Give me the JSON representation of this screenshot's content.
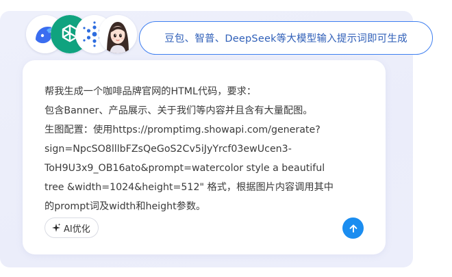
{
  "banner": {
    "text": "豆包、智普、DeepSeek等大模型输入提示词即可生成"
  },
  "avatars": [
    {
      "icon": "doubao-logo-icon"
    },
    {
      "icon": "chatgpt-logo-icon"
    },
    {
      "icon": "zhipu-logo-icon"
    },
    {
      "icon": "assistant-girl-avatar-icon"
    }
  ],
  "prompt": {
    "text": "帮我生成一个咖啡品牌官网的HTML代码，要求：\n包含Banner、产品展示、关于我们等内容并且含有大量配图。\n生图配置：使用https://promptimg.showapi.com/generate?\nsign=NpcSO8lllbFZsQeGoS2Cv5iJyYrcf03ewUcen3-\nToH9U3x9_OB16ato&prompt=watercolor style a beautiful\ntree &width=1024&height=512\"  格式，根据图片内容调用其中\n的prompt词及width和height参数。"
  },
  "actions": {
    "ai_optimize_label": "AI优化",
    "send_icon": "arrow-up-icon"
  },
  "colors": {
    "accent": "#1b8df0",
    "pill_border": "#3d7ef0",
    "pill_text": "#2f5fb8",
    "panel_bg": "#eceefb"
  }
}
